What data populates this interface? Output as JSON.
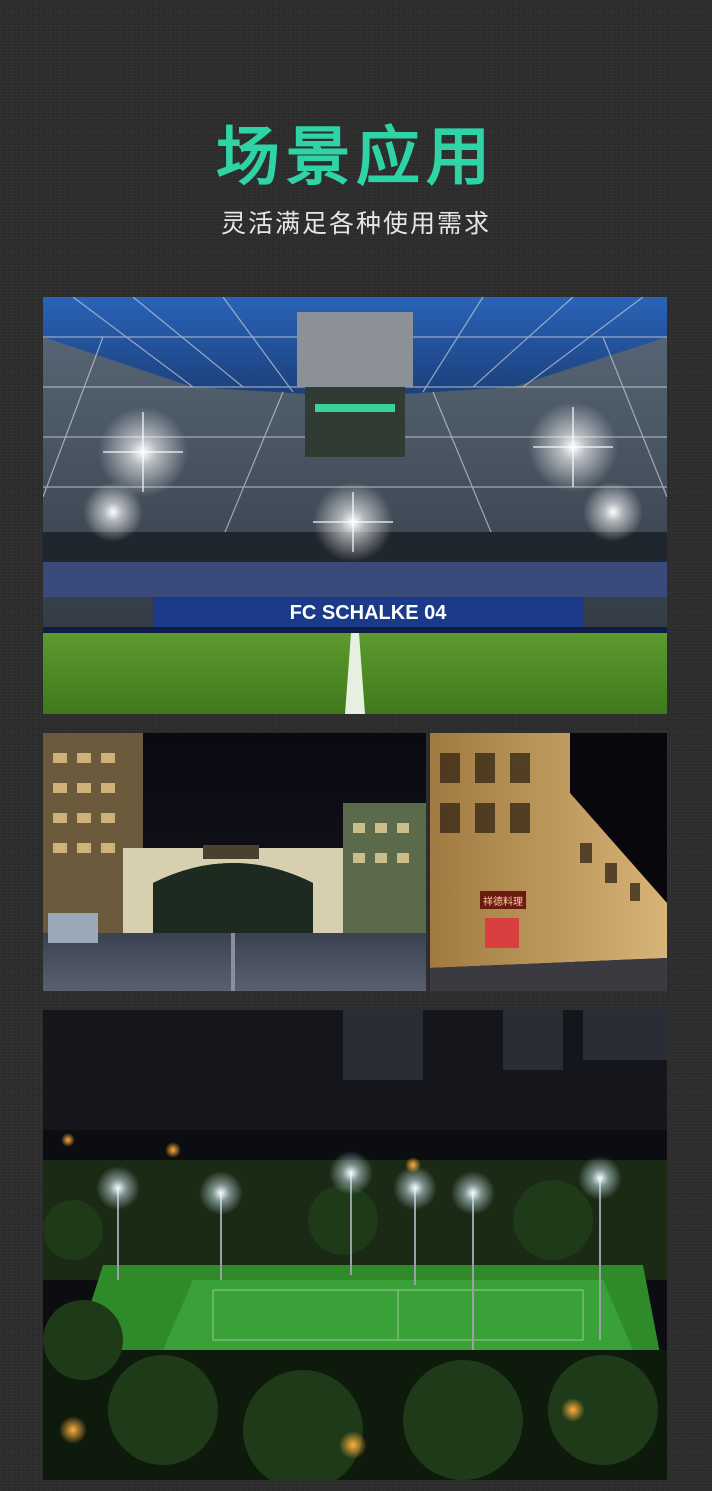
{
  "header": {
    "title": "场景应用",
    "subtitle": "灵活满足各种使用需求"
  },
  "colors": {
    "background": "#2c2c2c",
    "title": "#2ed3a6",
    "subtitle": "#e6e6e6"
  },
  "photos": [
    {
      "name": "stadium-photo",
      "sign_text": "FC SCHALKE 04"
    },
    {
      "name": "archway-photo"
    },
    {
      "name": "street-photo",
      "sign_text": "祥德料理"
    },
    {
      "name": "sports-fields-photo"
    }
  ]
}
